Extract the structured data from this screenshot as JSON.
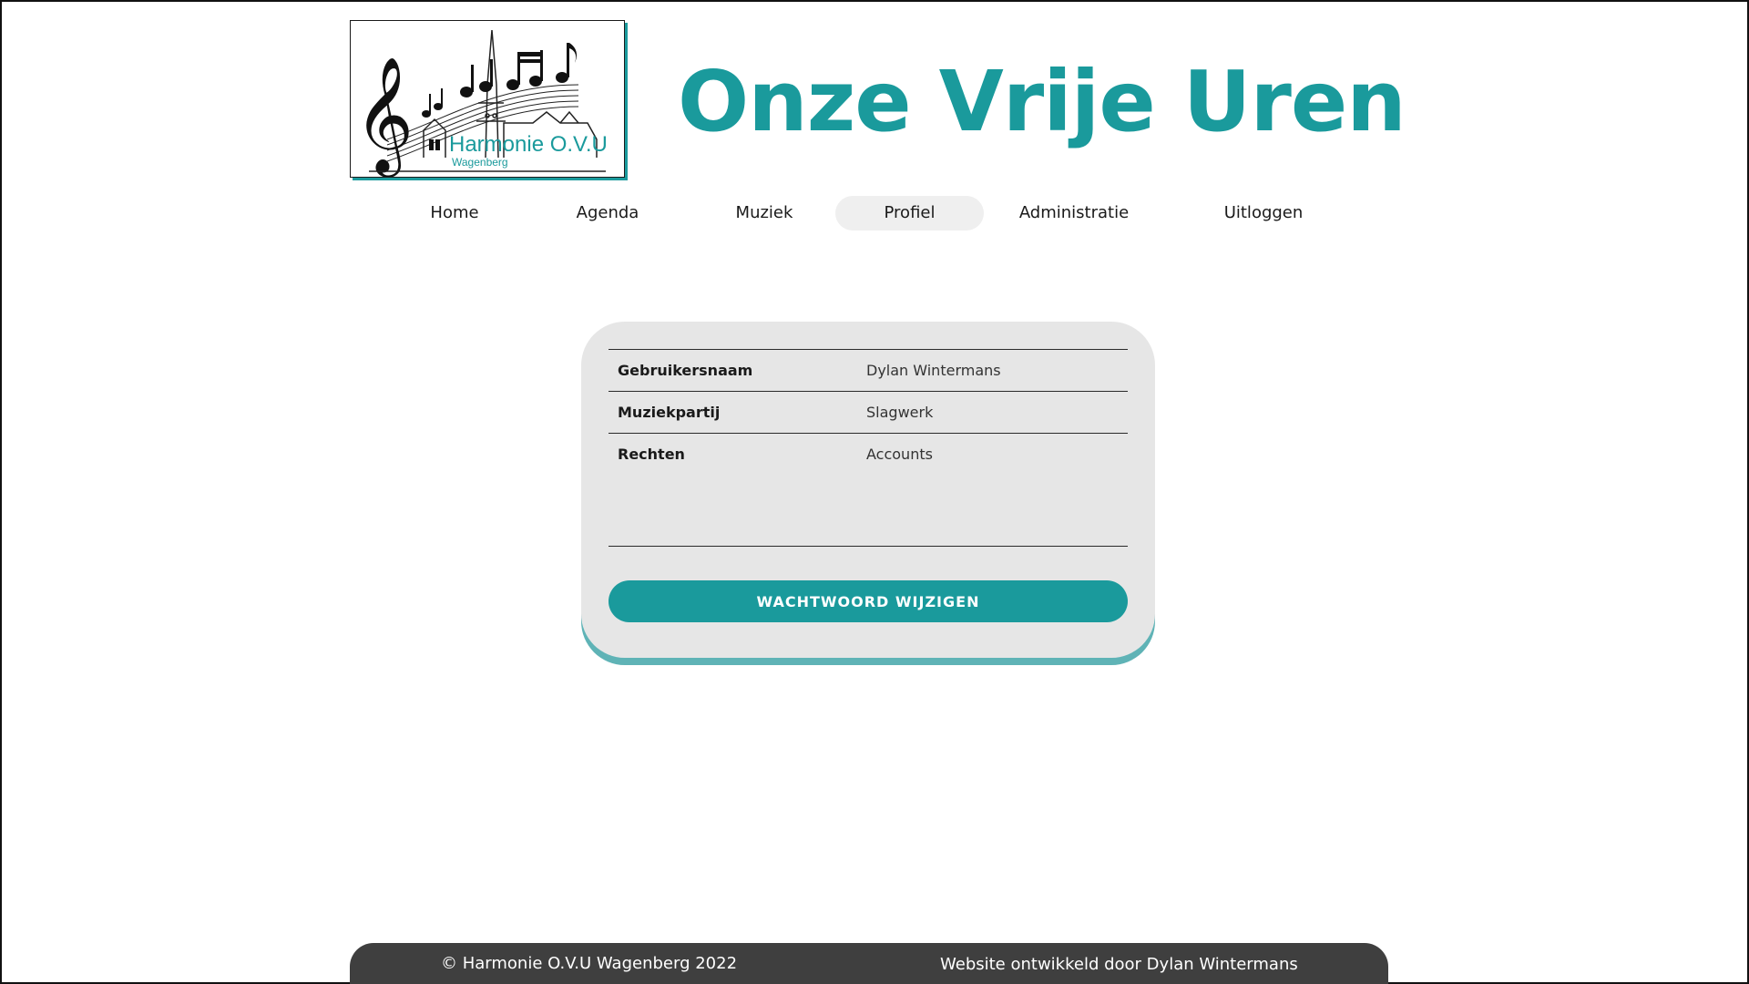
{
  "logo": {
    "title": "Harmonie O.V.U",
    "subtitle": "Wagenberg"
  },
  "header": {
    "title": "Onze Vrije Uren"
  },
  "nav": {
    "items": [
      {
        "label": "Home"
      },
      {
        "label": "Agenda"
      },
      {
        "label": "Muziek"
      },
      {
        "label": "Profiel",
        "active": true
      },
      {
        "label": "Administratie"
      },
      {
        "label": "Uitloggen"
      }
    ]
  },
  "profile": {
    "rows": [
      {
        "key": "Gebruikersnaam",
        "value": "Dylan Wintermans"
      },
      {
        "key": "Muziekpartij",
        "value": "Slagwerk"
      },
      {
        "key": "Rechten",
        "value": "Accounts"
      }
    ],
    "button_label": "WACHTWOORD WIJZIGEN"
  },
  "footer": {
    "copyright": "© Harmonie O.V.U Wagenberg 2022",
    "credit": "Website ontwikkeld door Dylan Wintermans"
  },
  "colors": {
    "accent": "#1a9a9c",
    "card_bg": "#e6e6e6",
    "footer_bg": "#3f3f3f"
  }
}
